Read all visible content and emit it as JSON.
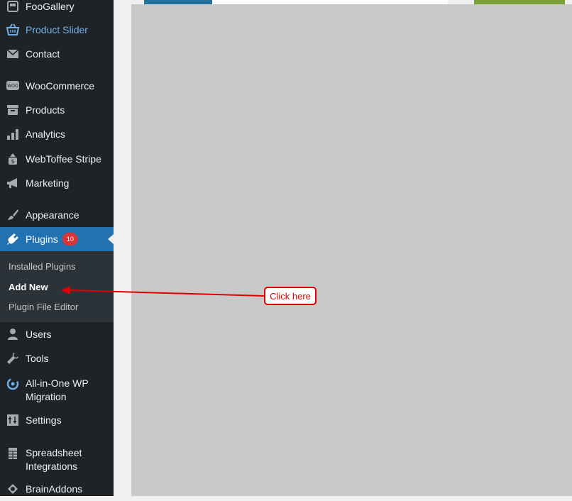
{
  "sidebar": {
    "items": [
      {
        "label": "FooGallery",
        "icon": "gallery-icon"
      },
      {
        "label": "Product Slider",
        "icon": "basket-icon"
      },
      {
        "label": "Contact",
        "icon": "mail-icon"
      },
      {
        "label": "WooCommerce",
        "icon": "woo-icon"
      },
      {
        "label": "Products",
        "icon": "archive-icon"
      },
      {
        "label": "Analytics",
        "icon": "bar-chart-icon"
      },
      {
        "label": "WebToffee Stripe",
        "icon": "money-icon"
      },
      {
        "label": "Marketing",
        "icon": "megaphone-icon"
      },
      {
        "label": "Appearance",
        "icon": "paintbrush-icon"
      },
      {
        "label": "Plugins",
        "icon": "plug-icon",
        "badge": "10"
      },
      {
        "label": "Users",
        "icon": "user-icon"
      },
      {
        "label": "Tools",
        "icon": "wrench-icon"
      },
      {
        "label": "All-in-One WP Migration",
        "icon": "migration-icon"
      },
      {
        "label": "Settings",
        "icon": "sliders-icon"
      },
      {
        "label": "Spreadsheet Integrations",
        "icon": "spreadsheet-icon"
      },
      {
        "label": "BrainAddons",
        "icon": "brain-icon"
      }
    ],
    "submenu": [
      "Installed Plugins",
      "Add New",
      "Plugin File Editor"
    ]
  },
  "annotation": {
    "callout": "Click here"
  },
  "colors": {
    "sidebar_bg": "#1d2327",
    "active_bg": "#2271b1",
    "submenu_bg": "#2c3338",
    "highlight_text": "#72aee6",
    "badge": "#d63638",
    "annotation_red": "#e00000",
    "overlay": "#c9c9c9"
  }
}
